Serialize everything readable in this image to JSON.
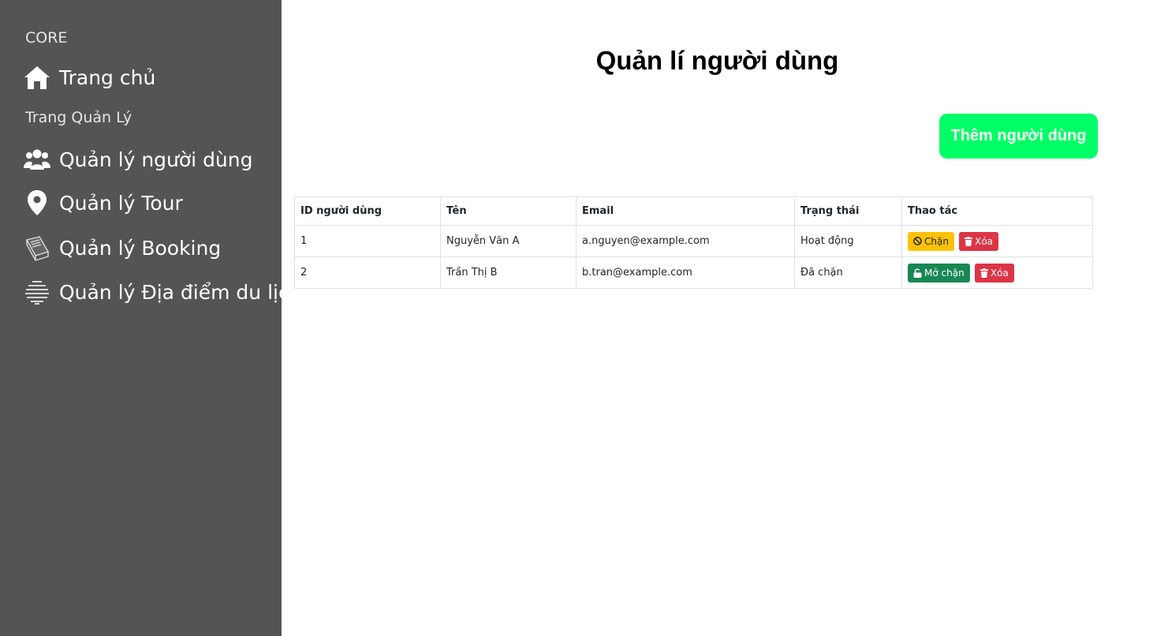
{
  "sidebar": {
    "core_heading": "CORE",
    "home_label": "Trang chủ",
    "manage_heading": "Trang Quản Lý",
    "items": [
      {
        "label": "Quản lý người dùng",
        "icon": "users-icon"
      },
      {
        "label": "Quản lý Tour",
        "icon": "map-pin-icon"
      },
      {
        "label": "Quản lý Booking",
        "icon": "book-icon"
      },
      {
        "label": "Quản lý Địa điểm du lịch",
        "icon": "globe-icon"
      }
    ]
  },
  "main": {
    "title": "Quản lí người dùng",
    "add_button": "Thêm người dùng"
  },
  "table": {
    "headers": [
      "ID người dùng",
      "Tên",
      "Email",
      "Trạng thái",
      "Thao tác"
    ],
    "rows": [
      {
        "id": "1",
        "name": "Nguyễn Văn A",
        "email": "a.nguyen@example.com",
        "status": "Hoạt động",
        "action1": "Chặn",
        "action2": "Xóa"
      },
      {
        "id": "2",
        "name": "Trần Thị B",
        "email": "b.tran@example.com",
        "status": "Đã chặn",
        "action1": "Mở chặn",
        "action2": "Xóa"
      }
    ]
  },
  "colors": {
    "sidebar_bg": "#545454",
    "add_button_bg": "#00ff66",
    "warning": "#ffc107",
    "danger": "#dc3545",
    "success": "#198754"
  }
}
